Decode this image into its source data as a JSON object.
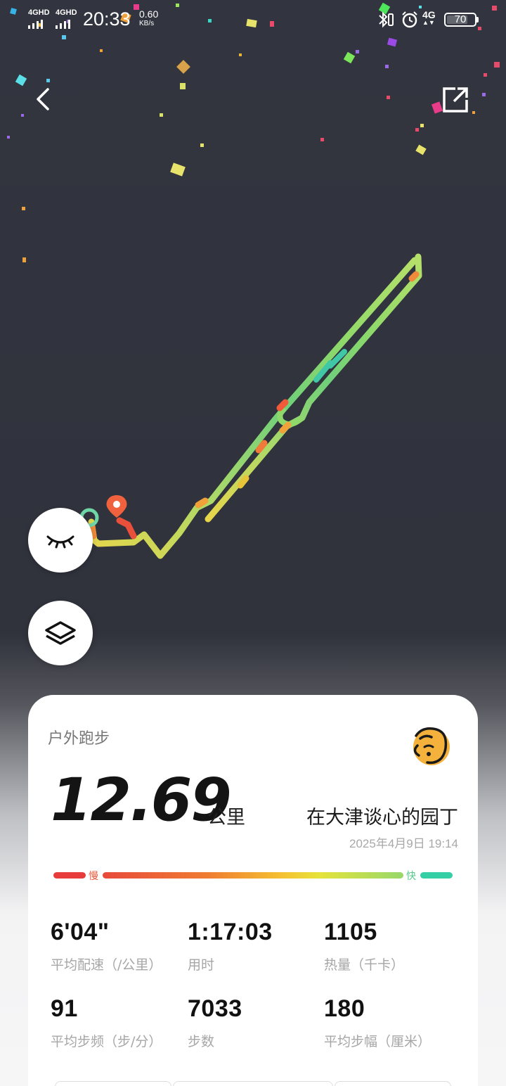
{
  "status_bar": {
    "signal1": "4GHD",
    "signal2": "4GHD",
    "time": "20:33",
    "net_speed": "0.60",
    "net_speed_unit": "KB/s",
    "network": "4G",
    "battery": "70",
    "icons": [
      "signal-icon",
      "bluetooth-icon",
      "alarm-icon",
      "battery-icon"
    ]
  },
  "header": {
    "back_icon": "chevron-left-icon",
    "share_icon": "share-export-icon"
  },
  "map": {
    "controls": [
      "eye-closed-icon",
      "layers-icon"
    ],
    "start_marker_color": "#6fd6a6",
    "end_marker_color": "#f0623d"
  },
  "card": {
    "activity_type": "户外跑步",
    "distance": "12.69",
    "distance_unit": "公里",
    "username": "在大津谈心的园丁",
    "datetime": "2025年4月9日 19:14",
    "pace_legend": {
      "slow": "慢",
      "fast": "快"
    },
    "stats": [
      {
        "value": "6'04\"",
        "label": "平均配速（/公里）"
      },
      {
        "value": "1:17:03",
        "label": "用时"
      },
      {
        "value": "1105",
        "label": "热量（千卡）"
      },
      {
        "value": "91",
        "label": "平均步频（步/分）"
      },
      {
        "value": "7033",
        "label": "步数"
      },
      {
        "value": "180",
        "label": "平均步幅（厘米）"
      }
    ]
  },
  "colors": {
    "background": "#30323c",
    "slow": "#e83b3b",
    "fast": "#35cfa6",
    "card": "#ffffff"
  }
}
